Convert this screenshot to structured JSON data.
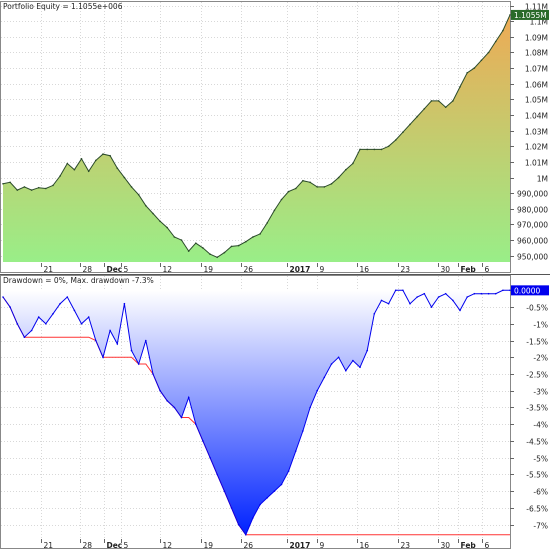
{
  "chart_data": [
    {
      "type": "area",
      "title": "Portfolio Equity = 1.1055e+006",
      "last_value_label": "1.1055M",
      "x_ticks": [
        "21",
        "28",
        "Dec",
        "5",
        "12",
        "19",
        "26",
        "2017",
        "9",
        "16",
        "23",
        "30",
        "Feb",
        "6"
      ],
      "y_ticks": [
        "950,000",
        "960,000",
        "970,000",
        "980,000",
        "990,000",
        "1M",
        "1.01M",
        "1.02M",
        "1.03M",
        "1.04M",
        "1.05M",
        "1.06M",
        "1.07M",
        "1.08M",
        "1.09M",
        "1.1M",
        "1.11M"
      ],
      "ylim": [
        946000,
        1111000
      ],
      "grid": true,
      "colors": {
        "fill_low": "#99ee88",
        "fill_high": "#eeaa55",
        "line": "#2a4a2a",
        "last_value_bg": "#2a6a2a"
      },
      "series": [
        {
          "values": [
            996000,
            997000,
            992000,
            994000,
            992000,
            993500,
            993000,
            995000,
            1001000,
            1009000,
            1005000,
            1012000,
            1004000,
            1011000,
            1015000,
            1014000,
            1006000,
            1000000,
            994000,
            989000,
            982000,
            977000,
            972000,
            968000,
            962000,
            960000,
            953000,
            958000,
            955000,
            951000,
            949000,
            952000,
            956000,
            956500,
            959000,
            962000,
            964000,
            971000,
            979000,
            986000,
            991000,
            993000,
            998000,
            997000,
            994000,
            994000,
            996000,
            1000000,
            1005000,
            1009000,
            1018000,
            1018000,
            1018000,
            1018000,
            1020000,
            1024000,
            1029000,
            1034000,
            1039000,
            1044000,
            1049000,
            1049000,
            1045000,
            1049000,
            1058000,
            1067000,
            1070000,
            1075000,
            1080000,
            1087000,
            1094000,
            1104000
          ]
        }
      ]
    },
    {
      "type": "area",
      "title": "Drawdown = 0%, Max. drawdown -7.3%",
      "last_value_label": "0.0000",
      "x_ticks": [
        "21",
        "28",
        "Dec",
        "5",
        "12",
        "19",
        "26",
        "2017",
        "9",
        "16",
        "23",
        "30",
        "Feb",
        "6"
      ],
      "y_ticks": [
        "-0.5%",
        "-1%",
        "-1.5%",
        "-2%",
        "-2.5%",
        "-3%",
        "-3.5%",
        "-4%",
        "-4.5%",
        "-5%",
        "-5.5%",
        "-6%",
        "-6.5%",
        "-7%"
      ],
      "ylim": [
        -7.4,
        0.1
      ],
      "grid": true,
      "colors": {
        "fill_top": "#ffffff",
        "fill_bottom": "#0022ff",
        "line": "#0000ee",
        "max_line": "#ff3333",
        "last_value_bg": "#0000ee"
      },
      "series": [
        {
          "values": [
            -0.2,
            -0.5,
            -1.0,
            -1.4,
            -1.2,
            -0.8,
            -1.0,
            -0.7,
            -0.4,
            -0.2,
            -0.6,
            -1.0,
            -0.8,
            -1.5,
            -2.0,
            -1.2,
            -1.6,
            -0.4,
            -1.8,
            -2.2,
            -1.5,
            -2.5,
            -3.0,
            -3.3,
            -3.5,
            -3.8,
            -3.2,
            -4.0,
            -4.5,
            -5.0,
            -5.5,
            -6.0,
            -6.5,
            -7.0,
            -7.3,
            -6.8,
            -6.4,
            -6.2,
            -6.0,
            -5.8,
            -5.4,
            -4.8,
            -4.2,
            -3.5,
            -3.0,
            -2.6,
            -2.2,
            -2.0,
            -2.4,
            -2.1,
            -2.3,
            -1.8,
            -0.7,
            -0.3,
            -0.4,
            0.0,
            0.0,
            -0.4,
            -0.2,
            -0.1,
            -0.5,
            -0.2,
            -0.1,
            -0.3,
            -0.6,
            -0.2,
            -0.1,
            -0.1,
            -0.1,
            -0.1,
            0.0,
            0.0
          ]
        },
        {
          "name": "",
          "values": [
            -0.2,
            -0.5,
            -1.0,
            -1.4,
            -1.4,
            -1.4,
            -1.4,
            -1.4,
            -1.4,
            -1.4,
            -1.4,
            -1.4,
            -1.4,
            -1.5,
            -2.0,
            -2.0,
            -2.0,
            -2.0,
            -2.0,
            -2.2,
            -2.2,
            -2.5,
            -3.0,
            -3.3,
            -3.5,
            -3.8,
            -3.8,
            -4.0,
            -4.5,
            -5.0,
            -5.5,
            -6.0,
            -6.5,
            -7.0,
            -7.3,
            -7.3,
            -7.3,
            -7.3,
            -7.3,
            -7.3,
            -7.3,
            -7.3,
            -7.3,
            -7.3,
            -7.3,
            -7.3,
            -7.3,
            -7.3,
            -7.3,
            -7.3,
            -7.3,
            -7.3,
            -7.3,
            -7.3,
            -7.3,
            -7.3,
            -7.3,
            -7.3,
            -7.3,
            -7.3,
            -7.3,
            -7.3,
            -7.3,
            -7.3,
            -7.3,
            -7.3,
            -7.3,
            -7.3,
            -7.3,
            -7.3,
            -7.3,
            -7.3
          ]
        }
      ]
    }
  ]
}
